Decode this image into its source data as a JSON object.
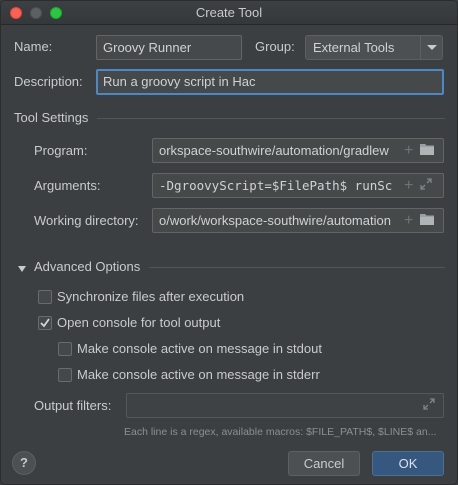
{
  "window": {
    "title": "Create Tool"
  },
  "name": {
    "label": "Name:",
    "value": "Groovy Runner"
  },
  "group": {
    "label": "Group:",
    "value": "External Tools"
  },
  "description": {
    "label": "Description:",
    "value": "Run a groovy script in Hac"
  },
  "tool_settings": {
    "title": "Tool Settings",
    "program": {
      "label": "Program:",
      "value": "orkspace-southwire/automation/gradlew"
    },
    "arguments": {
      "label": "Arguments:",
      "value": "-DgroovyScript=$FilePath$ runSc"
    },
    "working_dir": {
      "label": "Working directory:",
      "value": "o/work/workspace-southwire/automation"
    }
  },
  "advanced": {
    "title": "Advanced Options",
    "sync_files": {
      "label": "Synchronize files after execution",
      "checked": false
    },
    "open_console": {
      "label": "Open console for tool output",
      "checked": true
    },
    "stdout_active": {
      "label": "Make console active on message in stdout",
      "checked": false
    },
    "stderr_active": {
      "label": "Make console active on message in stderr",
      "checked": false
    },
    "output_filters": {
      "label": "Output filters:",
      "value": ""
    },
    "hint": "Each line is a regex, available macros: $FILE_PATH$, $LINE$ an..."
  },
  "buttons": {
    "help": "?",
    "cancel": "Cancel",
    "ok": "OK"
  },
  "colors": {
    "accent": "#4a88c7",
    "ok_button": "#365880",
    "background": "#3c3f41"
  }
}
